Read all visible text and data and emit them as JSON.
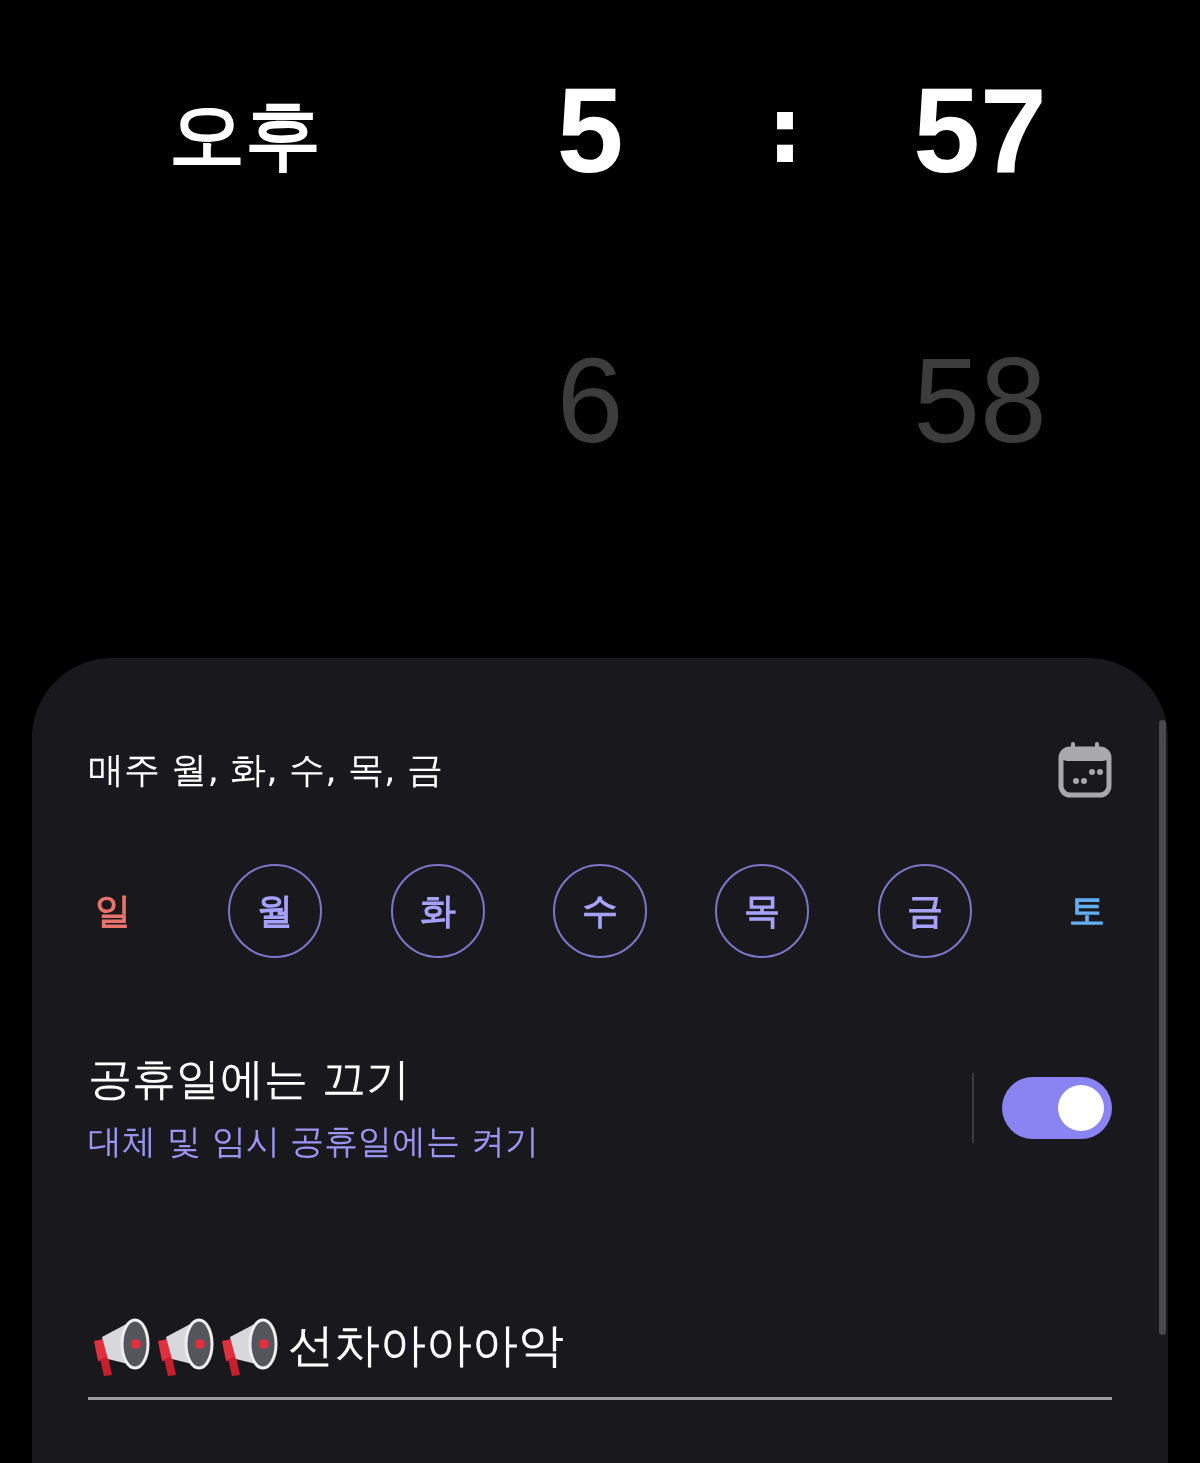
{
  "time_picker": {
    "meridiem": "오후",
    "hour": "5",
    "separator": ":",
    "minute": "57",
    "next_hour": "6",
    "next_minute": "58"
  },
  "repeat": {
    "summary": "매주 월, 화, 수, 목, 금"
  },
  "days": [
    {
      "label": "일",
      "color": "#e8736a",
      "selected": false
    },
    {
      "label": "월",
      "color": "#a6a1fa",
      "selected": true
    },
    {
      "label": "화",
      "color": "#a6a1fa",
      "selected": true
    },
    {
      "label": "수",
      "color": "#a6a1fa",
      "selected": true
    },
    {
      "label": "목",
      "color": "#a6a1fa",
      "selected": true
    },
    {
      "label": "금",
      "color": "#a6a1fa",
      "selected": true
    },
    {
      "label": "토",
      "color": "#62aef0",
      "selected": false
    }
  ],
  "holiday": {
    "title": "공휴일에는 끄기",
    "subtitle": "대체 및 임시 공휴일에는 켜기",
    "on": true
  },
  "alarm_name": {
    "value": "선차아아아악"
  }
}
